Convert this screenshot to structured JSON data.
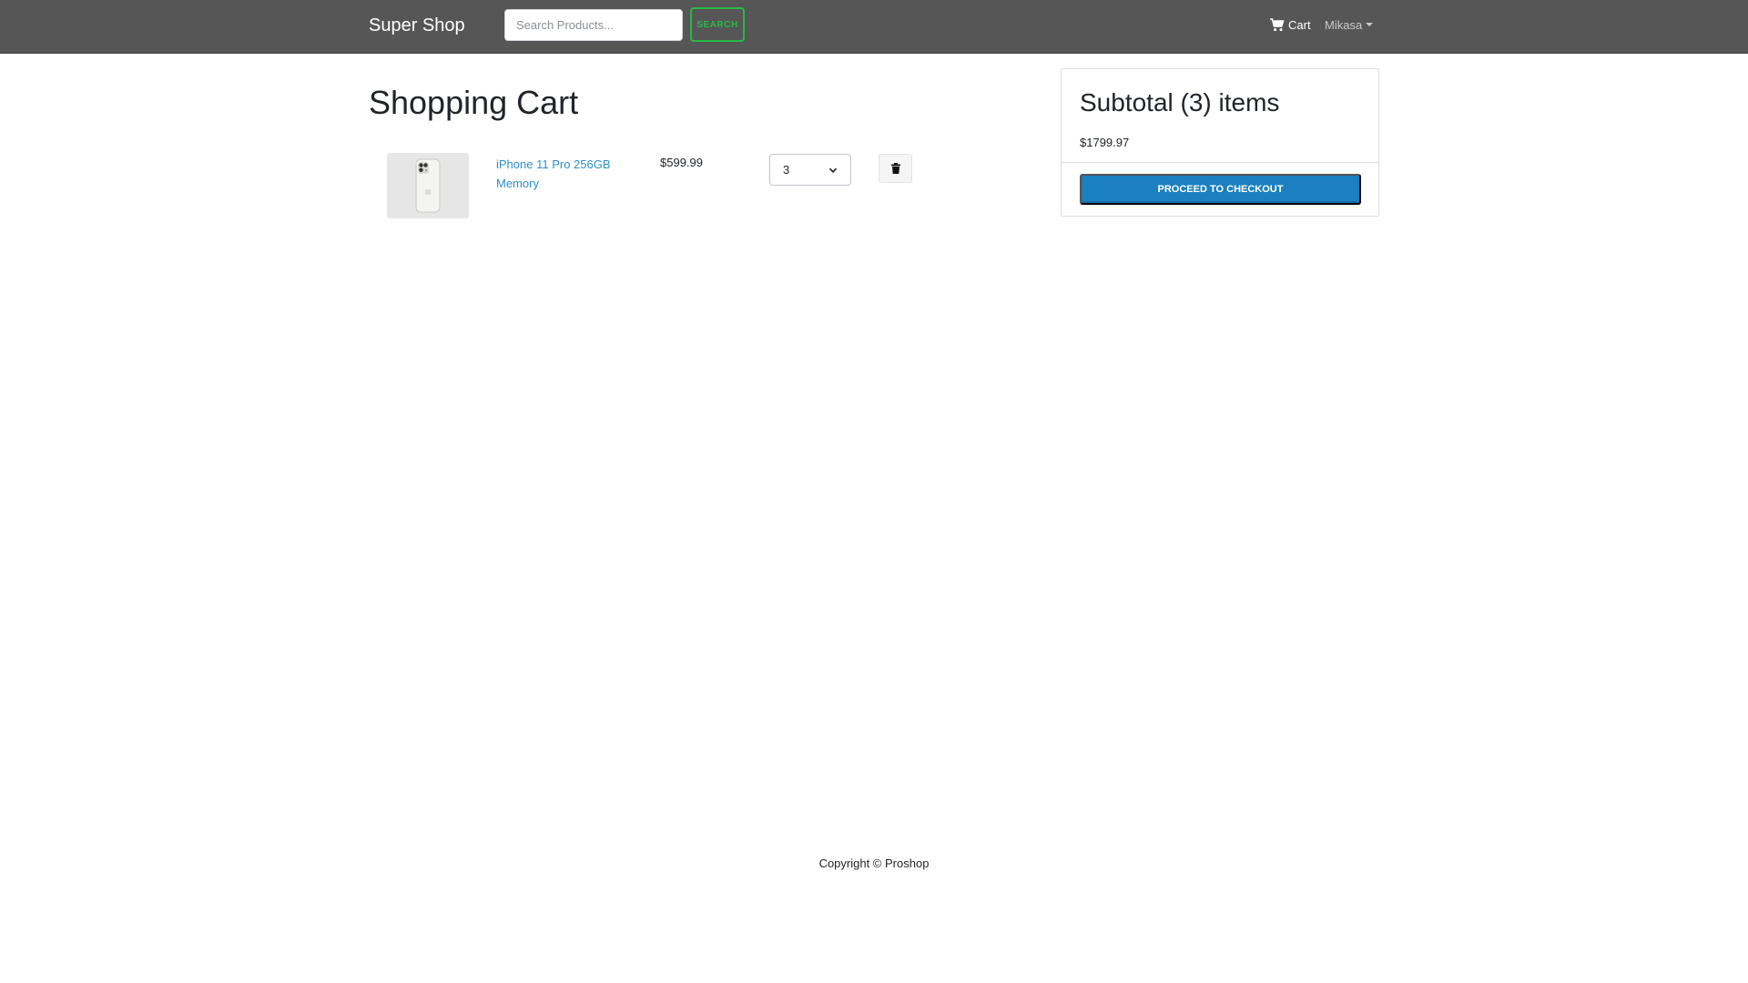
{
  "navbar": {
    "brand": "Super Shop",
    "search_placeholder": "Search Products...",
    "search_button": "SEARCH",
    "cart_label": "Cart",
    "user_name": "Mikasa",
    "accent_color": "#28b946"
  },
  "cart": {
    "title": "Shopping Cart",
    "items": [
      {
        "name": "iPhone 11 Pro 256GB Memory",
        "price": "$599.99",
        "quantity": "3",
        "image_icon": "phone-image"
      }
    ]
  },
  "summary": {
    "title": "Subtotal (3) items",
    "total": "$1799.97",
    "checkout_button": "PROCEED TO CHECKOUT",
    "button_color": "#1a80bf"
  },
  "footer": {
    "copyright": "Copyright © Proshop"
  }
}
